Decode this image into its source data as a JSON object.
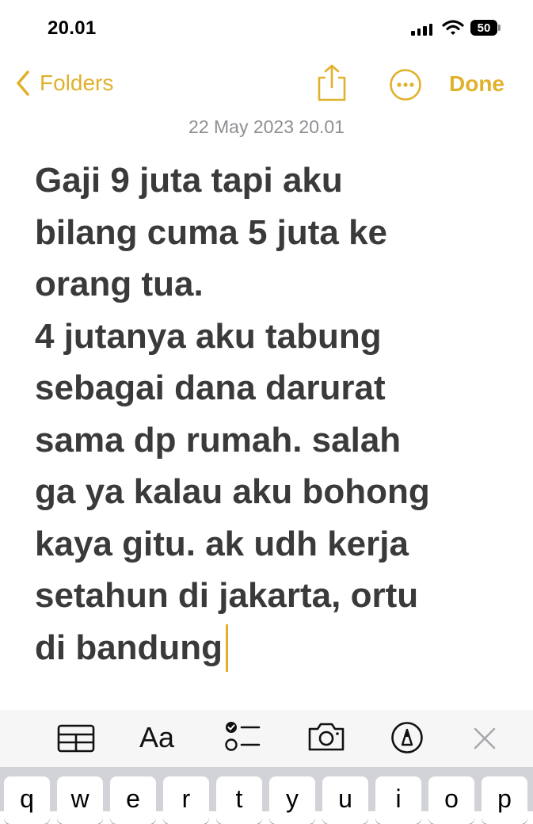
{
  "status_bar": {
    "time": "20.01",
    "battery": "50"
  },
  "nav": {
    "back_label": "Folders",
    "done_label": "Done",
    "accent_color": "#e1b12c"
  },
  "note": {
    "date": "22 May 2023 20.01",
    "lines": [
      "Gaji 9 juta tapi aku",
      "bilang cuma 5 juta ke",
      "orang tua.",
      "4 jutanya aku tabung",
      "sebagai dana darurat",
      "sama dp rumah. salah",
      "ga ya kalau aku bohong",
      "kaya gitu. ak udh kerja",
      "setahun di jakarta, ortu",
      "di bandung"
    ]
  },
  "toolbar": {
    "format_label": "Aa",
    "icons": [
      "table-icon",
      "text-format-icon",
      "checklist-icon",
      "camera-icon",
      "markup-pen-icon",
      "close-icon"
    ]
  },
  "keyboard": {
    "keys": [
      "q",
      "w",
      "e",
      "r",
      "t",
      "y",
      "u",
      "i",
      "o",
      "p"
    ]
  }
}
